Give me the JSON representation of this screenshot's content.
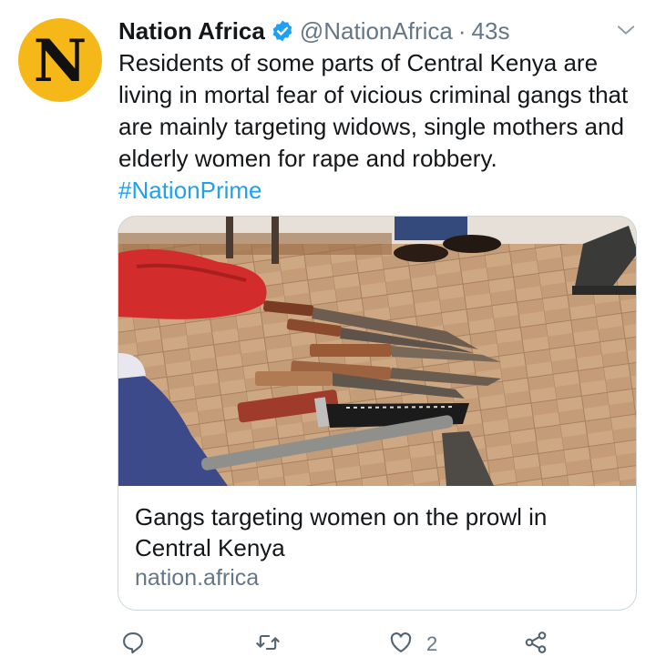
{
  "tweet": {
    "avatar_letter": "N",
    "display_name": "Nation Africa",
    "handle": "@NationAfrica",
    "separator": "·",
    "time": "43s",
    "text": "Residents of some parts of Central Kenya are living in mortal fear of vicious criminal gangs that are mainly targeting widows, single mothers and elderly women for rape and robbery. ",
    "hashtag": "#NationPrime"
  },
  "card": {
    "title": "Gangs targeting women on the prowl in Central Kenya",
    "domain": "nation.africa"
  },
  "actions": {
    "reply_icon": "reply-icon",
    "retweet_icon": "retweet-icon",
    "like_icon": "heart-icon",
    "like_count": "2",
    "share_icon": "share-icon"
  },
  "colors": {
    "accent": "#1da1f2",
    "muted": "#657786",
    "avatar_bg": "#f6b819"
  }
}
